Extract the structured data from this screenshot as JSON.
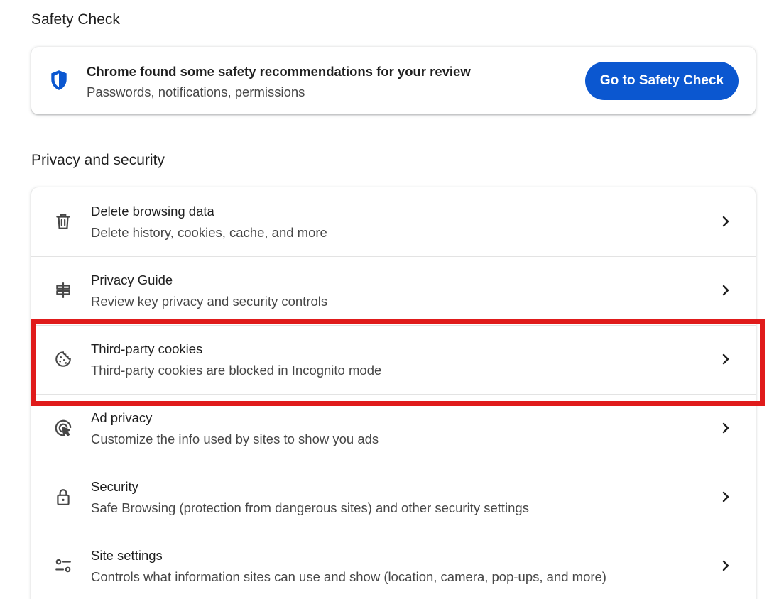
{
  "safety_check": {
    "heading": "Safety Check",
    "title": "Chrome found some safety recommendations for your review",
    "subtitle": "Passwords, notifications, permissions",
    "button_label": "Go to Safety Check",
    "icon": "shield-icon"
  },
  "privacy": {
    "heading": "Privacy and security",
    "items": [
      {
        "icon": "trash-icon",
        "title": "Delete browsing data",
        "subtitle": "Delete history, cookies, cache, and more"
      },
      {
        "icon": "signpost-icon",
        "title": "Privacy Guide",
        "subtitle": "Review key privacy and security controls"
      },
      {
        "icon": "cookie-icon",
        "title": "Third-party cookies",
        "subtitle": "Third-party cookies are blocked in Incognito mode"
      },
      {
        "icon": "ad-privacy-icon",
        "title": "Ad privacy",
        "subtitle": "Customize the info used by sites to show you ads"
      },
      {
        "icon": "lock-icon",
        "title": "Security",
        "subtitle": "Safe Browsing (protection from dangerous sites) and other security settings"
      },
      {
        "icon": "site-settings-icon",
        "title": "Site settings",
        "subtitle": "Controls what information sites can use and show (location, camera, pop-ups, and more)"
      }
    ]
  },
  "colors": {
    "accent": "#0b57d0",
    "highlight": "#e01b1b",
    "icon": "#474747"
  }
}
